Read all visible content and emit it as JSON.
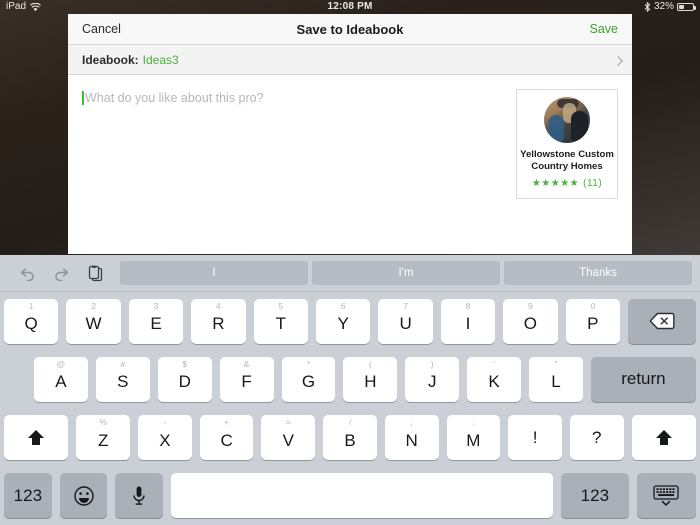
{
  "status_bar": {
    "device_label": "iPad",
    "wifi_icon": "wifi-icon",
    "time": "12:08 PM",
    "bluetooth_icon": "bluetooth-icon",
    "battery_percent": "32%",
    "battery_level": 32
  },
  "sheet": {
    "nav": {
      "cancel_label": "Cancel",
      "title": "Save to Ideabook",
      "save_label": "Save",
      "save_color": "#3aa32a"
    },
    "ideabook_row": {
      "label": "Ideabook:",
      "value": "Ideas3",
      "value_color": "#4caf3e",
      "chevron_icon": "chevron-right-icon"
    },
    "compose": {
      "placeholder": "What do you like about this pro?",
      "value": "",
      "caret_color": "#35c22a"
    },
    "pro_card": {
      "avatar_icon": "pro-avatar-photo",
      "name": "Yellowstone Custom Country Homes",
      "stars": "★★★★★",
      "star_count": 5,
      "review_count": "(11)",
      "rating_color": "#4caf3e"
    }
  },
  "keyboard": {
    "predictive": {
      "undo_icon": "undo-icon",
      "redo_icon": "redo-icon",
      "paste_icon": "copy-paste-icon",
      "suggestions": [
        "I",
        "I'm",
        "Thanks"
      ]
    },
    "row1": [
      {
        "main": "Q",
        "hint": "1"
      },
      {
        "main": "W",
        "hint": "2"
      },
      {
        "main": "E",
        "hint": "3"
      },
      {
        "main": "R",
        "hint": "4"
      },
      {
        "main": "T",
        "hint": "5"
      },
      {
        "main": "Y",
        "hint": "6"
      },
      {
        "main": "U",
        "hint": "7"
      },
      {
        "main": "I",
        "hint": "8"
      },
      {
        "main": "O",
        "hint": "9"
      },
      {
        "main": "P",
        "hint": "0"
      }
    ],
    "backspace_icon": "backspace-icon",
    "row2": [
      {
        "main": "A",
        "hint": "@"
      },
      {
        "main": "S",
        "hint": "#"
      },
      {
        "main": "D",
        "hint": "$"
      },
      {
        "main": "F",
        "hint": "&"
      },
      {
        "main": "G",
        "hint": "*"
      },
      {
        "main": "H",
        "hint": "("
      },
      {
        "main": "J",
        "hint": ")"
      },
      {
        "main": "K",
        "hint": "'"
      },
      {
        "main": "L",
        "hint": "\""
      }
    ],
    "return_label": "return",
    "row3": [
      {
        "main": "Z",
        "hint": "%"
      },
      {
        "main": "X",
        "hint": "-"
      },
      {
        "main": "C",
        "hint": "+"
      },
      {
        "main": "V",
        "hint": "="
      },
      {
        "main": "B",
        "hint": "/"
      },
      {
        "main": "N",
        "hint": ";"
      },
      {
        "main": "M",
        "hint": ":"
      },
      {
        "main": "!",
        "hint": ""
      },
      {
        "main": "?",
        "hint": ""
      }
    ],
    "shift_left_icon": "shift-icon",
    "shift_right_icon": "shift-icon",
    "row4": {
      "numbers_left_label": "123",
      "emoji_icon": "emoji-smiley-icon",
      "dictation_icon": "microphone-icon",
      "space_label": "",
      "numbers_right_label": "123",
      "hide_keyboard_icon": "hide-keyboard-icon"
    }
  }
}
